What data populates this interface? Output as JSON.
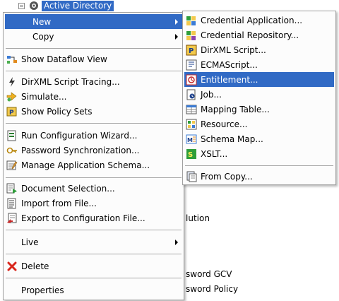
{
  "tree": {
    "top_label": "Active Directory",
    "bg_items": [
      "lution",
      "sword GCV",
      "sword Policy"
    ]
  },
  "context_menu": {
    "items": [
      {
        "label": "New",
        "icon": "none",
        "submenu": true,
        "highlighted": true
      },
      {
        "label": "Copy",
        "icon": "none",
        "submenu": true
      },
      {
        "label": "Show Dataflow View",
        "icon": "dataflow-icon"
      },
      {
        "label": "DirXML Script Tracing...",
        "icon": "trace-icon"
      },
      {
        "label": "Simulate...",
        "icon": "simulate-icon"
      },
      {
        "label": "Show Policy Sets",
        "icon": "policy-sets-icon"
      },
      {
        "label": "Run Configuration Wizard...",
        "icon": "wizard-icon"
      },
      {
        "label": "Password Synchronization...",
        "icon": "password-sync-icon"
      },
      {
        "label": "Manage Application Schema...",
        "icon": "schema-icon"
      },
      {
        "label": "Document Selection...",
        "icon": "document-icon"
      },
      {
        "label": "Import from File...",
        "icon": "import-icon"
      },
      {
        "label": "Export to Configuration File...",
        "icon": "export-icon"
      },
      {
        "label": "Live",
        "icon": "none",
        "submenu": true
      },
      {
        "label": "Delete",
        "icon": "delete-x-icon"
      },
      {
        "label": "Properties",
        "icon": "none"
      }
    ]
  },
  "new_submenu": {
    "items": [
      {
        "label": "Credential Application...",
        "icon": "credential-app-icon"
      },
      {
        "label": "Credential Repository...",
        "icon": "credential-repo-icon"
      },
      {
        "label": "DirXML Script...",
        "icon": "dirxml-script-icon"
      },
      {
        "label": "ECMAScript...",
        "icon": "ecmascript-icon"
      },
      {
        "label": "Entitlement...",
        "icon": "entitlement-icon",
        "highlighted": true
      },
      {
        "label": "Job...",
        "icon": "job-icon"
      },
      {
        "label": "Mapping Table...",
        "icon": "mapping-table-icon"
      },
      {
        "label": "Resource...",
        "icon": "resource-icon"
      },
      {
        "label": "Schema Map...",
        "icon": "schema-map-icon"
      },
      {
        "label": "XSLT...",
        "icon": "xslt-icon"
      },
      {
        "label": "From Copy...",
        "icon": "from-copy-icon"
      }
    ]
  },
  "colors": {
    "highlight": "#316ac5",
    "menu_bg": "#fcfcfc",
    "border": "#a0a0a0",
    "delete_red": "#d9261c"
  }
}
